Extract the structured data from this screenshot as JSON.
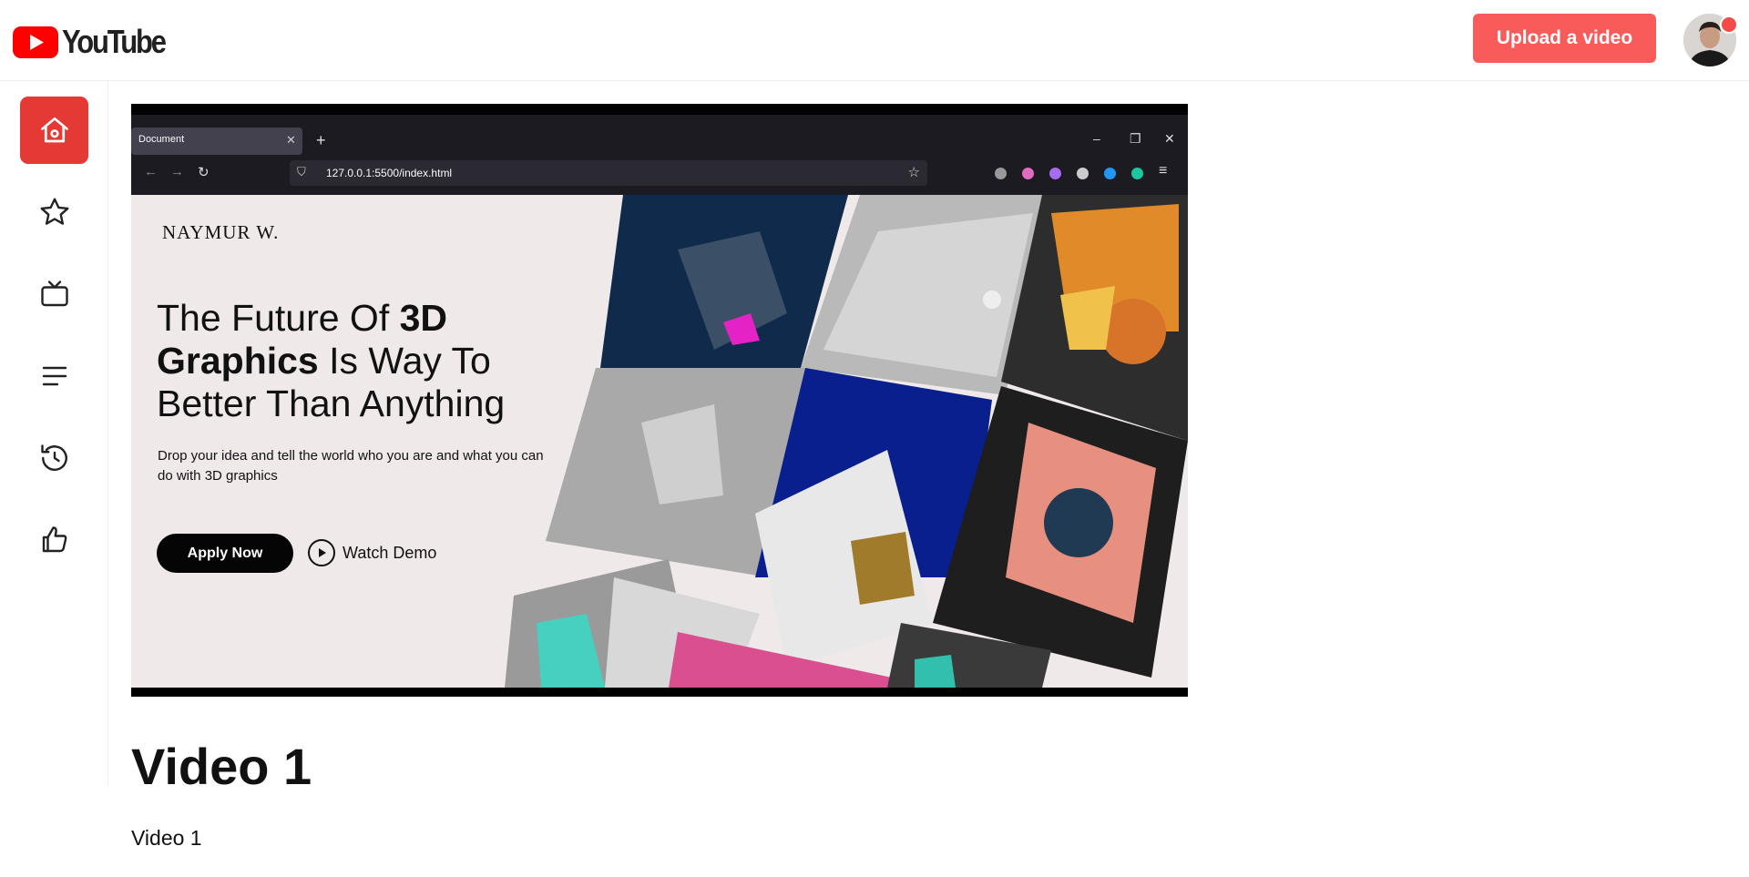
{
  "header": {
    "logo_text": "YouTube",
    "upload_label": "Upload a video",
    "brand_color": "#f95a5a",
    "logo_red": "#ff0000"
  },
  "sidebar": {
    "items": [
      {
        "name": "home",
        "icon": "home-icon",
        "active": true
      },
      {
        "name": "favorites",
        "icon": "star-icon"
      },
      {
        "name": "tv",
        "icon": "tv-icon"
      },
      {
        "name": "playlist",
        "icon": "list-icon"
      },
      {
        "name": "history",
        "icon": "history-icon"
      },
      {
        "name": "liked",
        "icon": "thumbs-up-icon"
      }
    ],
    "active_color": "#e53935"
  },
  "video": {
    "browser": {
      "tab_label": "Document",
      "address": "127.0.0.1:5500/index.html"
    },
    "site": {
      "brand": "NAYMUR W.",
      "headline_part1": "The Future Of ",
      "headline_bold1": "3D",
      "headline_bold2": "Graphics",
      "headline_part2": " Is Way To Better Than Anything",
      "paragraph": "Drop your idea and tell the world who you are and what you can do with 3D graphics",
      "apply_label": "Apply Now",
      "watch_label": "Watch Demo"
    }
  },
  "content": {
    "title": "Video 1",
    "description": "Video 1"
  }
}
